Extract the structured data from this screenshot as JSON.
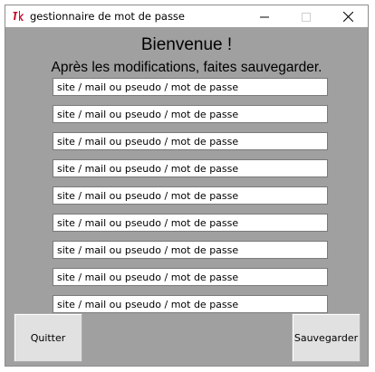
{
  "window": {
    "title": "gestionnaire de mot de passe",
    "icon": "tk-feather-icon",
    "controls": [
      "minimize-icon",
      "maximize-icon",
      "close-icon"
    ]
  },
  "header": {
    "welcome": "Bienvenue !",
    "instruction": "Après les modifications, faites sauvegarder."
  },
  "entries": [
    "site / mail ou pseudo / mot de passe",
    "site / mail ou pseudo / mot de passe",
    "site / mail ou pseudo / mot de passe",
    "site / mail ou pseudo / mot de passe",
    "site / mail ou pseudo / mot de passe",
    "site / mail ou pseudo / mot de passe",
    "site / mail ou pseudo / mot de passe",
    "site / mail ou pseudo / mot de passe",
    "site / mail ou pseudo / mot de passe"
  ],
  "buttons": {
    "quit": "Quitter",
    "save": "Sauvegarder"
  },
  "colors": {
    "background": "#a0a0a0",
    "button_face": "#e1e1e1",
    "icon_accent": "#c8102e"
  }
}
